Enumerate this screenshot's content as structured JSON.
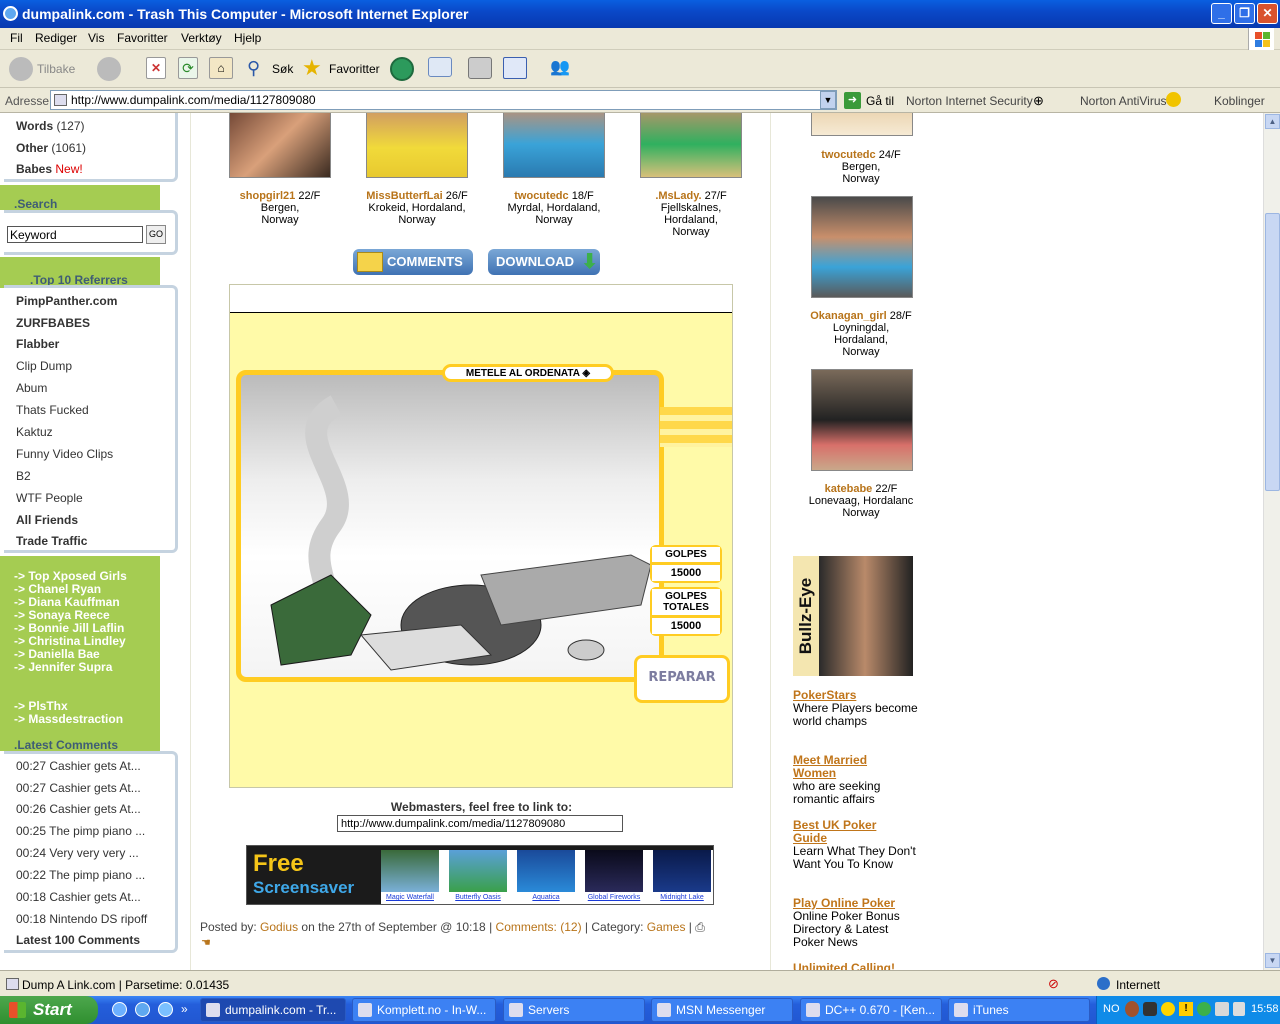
{
  "window": {
    "title": "dumpalink.com - Trash This Computer - Microsoft Internet Explorer"
  },
  "menu": [
    "Fil",
    "Rediger",
    "Vis",
    "Favoritter",
    "Verktøy",
    "Hjelp"
  ],
  "toolbar": {
    "back": "Tilbake",
    "search": "Søk",
    "favorites": "Favoritter"
  },
  "address": {
    "label": "Adresse",
    "url": "http://www.dumpalink.com/media/1127809080",
    "go": "Gå til",
    "norton_security": "Norton Internet Security",
    "norton_av": "Norton AntiVirus",
    "links": "Koblinger"
  },
  "left": {
    "categories": [
      {
        "label": "Words",
        "count": "(127)"
      },
      {
        "label": "Other",
        "count": "(1061)"
      },
      {
        "label": "Babes",
        "count": "New!"
      }
    ],
    "search_title": ".Search",
    "search_placeholder": "Keyword",
    "search_go": "GO",
    "referrers_title": ".Top 10 Referrers",
    "referrers": [
      "PimpPanther.com",
      "ZURFBABES",
      "Flabber",
      "Clip Dump",
      "Abum",
      "Thats Fucked",
      "Kaktuz",
      "Funny Video Clips",
      "B2",
      "WTF People",
      "All Friends",
      "Trade Traffic"
    ],
    "green_links": [
      "-> Top Xposed Girls",
      "-> Chanel Ryan",
      "-> Diana Kauffman",
      "-> Sonaya Reece",
      "-> Bonnie Jill Laflin",
      "-> Christina Lindley",
      "-> Daniella Bae",
      "-> Jennifer Supra",
      "-> PlsThx",
      "-> Massdestraction"
    ],
    "latest_title": ".Latest Comments",
    "latest": [
      "00:27 Cashier gets At...",
      "00:27 Cashier gets At...",
      "00:26 Cashier gets At...",
      "00:25 The pimp piano ...",
      "00:24 Very very very ...",
      "00:22 The pimp piano ...",
      "00:18 Cashier gets At...",
      "00:18 Nintendo DS ripoff"
    ],
    "latest_all": "Latest 100 Comments"
  },
  "center": {
    "profiles": [
      {
        "name": "shopgirl21",
        "age": "22/F",
        "loc1": "Bergen,",
        "loc2": "Norway",
        "loc3": ""
      },
      {
        "name": "MissButterfLai",
        "age": "26/F",
        "loc1": "Krokeid, Hordaland,",
        "loc2": "Norway",
        "loc3": ""
      },
      {
        "name": "twocutedc",
        "age": "18/F",
        "loc1": "Myrdal, Hordaland,",
        "loc2": "Norway",
        "loc3": ""
      },
      {
        "name": ".MsLady.",
        "age": "27/F",
        "loc1": "Fjellskalnes,",
        "loc2": "Hordaland,",
        "loc3": "Norway"
      }
    ],
    "comments_btn": "COMMENTS",
    "download_btn": "DOWNLOAD",
    "game": {
      "title": "METELE AL ORDENATA",
      "golpes_label": "GOLPES",
      "golpes_value": "15000",
      "totales_label1": "GOLPES",
      "totales_label2": "TOTALES",
      "totales_value": "15000",
      "repair": "REPARAR"
    },
    "webmasters": "Webmasters, feel free to link to:",
    "link_url": "http://www.dumpalink.com/media/1127809080",
    "banner": {
      "line1": "Free",
      "line2": "Screensaver",
      "items": [
        "Magic Waterfall",
        "Butterfly Oasis",
        "Aquatica",
        "Global Fireworks",
        "Midnight Lake"
      ]
    },
    "posted": {
      "by_label": "Posted by:",
      "author": "Godius",
      "date": "on the 27th of September @ 10:18",
      "sep": "|",
      "comments": "Comments: (12)",
      "category_label": "Category:",
      "category": "Games"
    }
  },
  "right": {
    "profiles": [
      {
        "name": "twocutedc",
        "age": "24/F",
        "loc1": "Bergen,",
        "loc2": "Norway",
        "loc3": ""
      },
      {
        "name": "Okanagan_girl",
        "age": "28/F",
        "loc1": "Loyningdal,",
        "loc2": "Hordaland,",
        "loc3": "Norway"
      },
      {
        "name": "katebabe",
        "age": "22/F",
        "loc1": "Lonevaag, Hordalanc",
        "loc2": "Norway",
        "loc3": ""
      }
    ],
    "bullz": "Bullz-Eye",
    "ads": [
      {
        "title": "PokerStars",
        "desc": "Where Players become world champs"
      },
      {
        "title": "Meet Married Women",
        "desc": "who are seeking romantic affairs"
      },
      {
        "title": "Best UK Poker Guide",
        "desc": "Learn What They Don't Want You To Know"
      },
      {
        "title": "Play Online Poker",
        "desc": "Online Poker Bonus Directory & Latest Poker News"
      },
      {
        "title": "Unlimited Calling!",
        "desc": ""
      }
    ]
  },
  "status": {
    "text": "Dump A Link.com | Parsetime: 0.01435",
    "zone": "Internett"
  },
  "taskbar": {
    "start": "Start",
    "tasks": [
      "dumpalink.com - Tr...",
      "Komplett.no - In-W...",
      "Servers",
      "MSN Messenger",
      "DC++ 0.670 - [Ken...",
      "iTunes"
    ],
    "lang": "NO",
    "clock": "15:58"
  }
}
